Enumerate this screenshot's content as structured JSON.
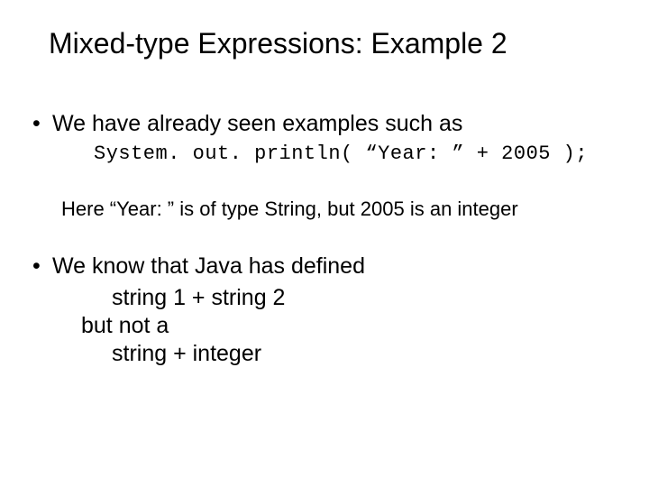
{
  "title": "Mixed-type Expressions: Example 2",
  "bullets": {
    "b1": "We have already seen examples such as",
    "b2": "We know that Java has defined"
  },
  "code": "System. out. println( “Year: ” + 2005 );",
  "note": "Here “Year: ” is of type String, but 2005 is an integer",
  "sub": {
    "s1": "string 1 + string 2",
    "s2": "but not a",
    "s3": "string + integer"
  }
}
